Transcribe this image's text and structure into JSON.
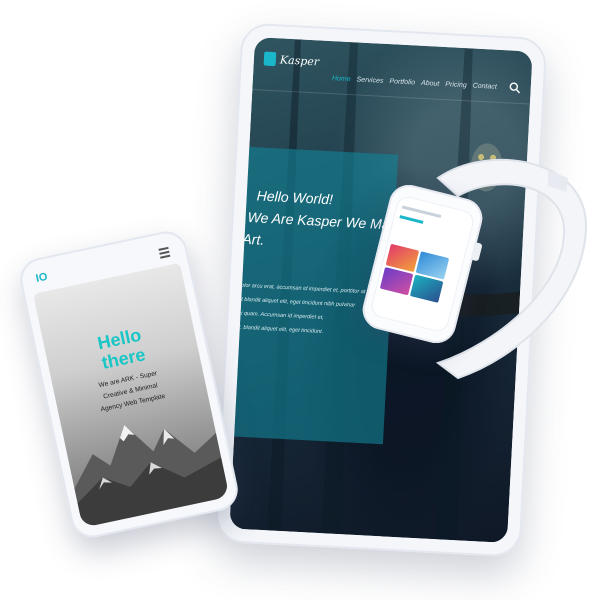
{
  "tablet": {
    "brand": "Kasper",
    "nav": [
      "Home",
      "Services",
      "Portfolio",
      "About",
      "Pricing",
      "Contact"
    ],
    "hero_lines": [
      "Hello World!",
      "We Are Kasper We Make",
      "Art."
    ],
    "body_lines": [
      "dolor arcu erat, accumsan id imperdiet et, porttitor at",
      "sit blandit aliquet elit, eget tincidunt nibh pulvinar",
      "rci quam. Accumsan id imperdiet et,",
      "at. blandit aliquet elit, eget tincidunt."
    ],
    "search_icon": "search-icon"
  },
  "phone": {
    "logo": "IO",
    "title_line1": "Hello",
    "title_line2": "there",
    "subtitle": [
      "We are ARK - Super",
      "Creative & Minimal",
      "Agency Web Template"
    ]
  },
  "colors": {
    "accent": "#19b7c9",
    "device_frame": "#f4f6fa"
  }
}
